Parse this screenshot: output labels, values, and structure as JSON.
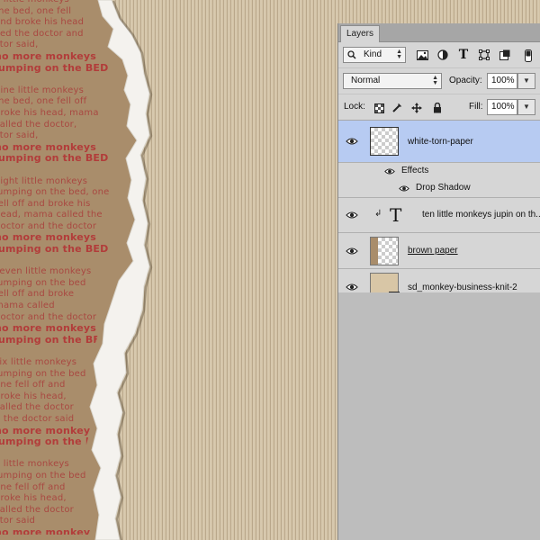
{
  "canvas": {
    "text_lines": [
      {
        "text": "e little monkeys",
        "emph": false
      },
      {
        "text": "the bed, one fell",
        "emph": false
      },
      {
        "text": "and broke his head",
        "emph": false
      },
      {
        "text": "lled the doctor and",
        "emph": false
      },
      {
        "text": "ctor said,",
        "emph": false
      },
      {
        "text": "no more monkeys",
        "emph": true
      },
      {
        "text": "jumping on the BED",
        "emph": true
      },
      {
        "text": "",
        "emph": false
      },
      {
        "text": "nine little monkeys",
        "emph": false
      },
      {
        "text": "the bed, one fell off",
        "emph": false
      },
      {
        "text": "broke his head, mama",
        "emph": false
      },
      {
        "text": "called the doctor,",
        "emph": false
      },
      {
        "text": "ctor said,",
        "emph": false
      },
      {
        "text": "no more monkeys",
        "emph": true
      },
      {
        "text": "jumping on the BED",
        "emph": true
      },
      {
        "text": "",
        "emph": false
      },
      {
        "text": "eight little monkeys",
        "emph": false
      },
      {
        "text": "jumping on the bed, one",
        "emph": false
      },
      {
        "text": "fell off and broke his",
        "emph": false
      },
      {
        "text": "head, mama called the",
        "emph": false
      },
      {
        "text": "doctor and the doctor",
        "emph": false
      },
      {
        "text": "no more monkeys",
        "emph": true
      },
      {
        "text": "jumping on the BED",
        "emph": true
      },
      {
        "text": "",
        "emph": false
      },
      {
        "text": "seven little monkeys",
        "emph": false
      },
      {
        "text": "jumping on the bed",
        "emph": false
      },
      {
        "text": "fell off and broke",
        "emph": false
      },
      {
        "text": "mama called",
        "emph": false
      },
      {
        "text": "doctor and the doctor",
        "emph": false
      },
      {
        "text": "no more monkeys",
        "emph": true
      },
      {
        "text": "jumping on the BED",
        "emph": true
      },
      {
        "text": "",
        "emph": false
      },
      {
        "text": "six little monkeys",
        "emph": false
      },
      {
        "text": "jumping on the bed",
        "emph": false
      },
      {
        "text": "one fell off and",
        "emph": false
      },
      {
        "text": "broke his head,",
        "emph": false
      },
      {
        "text": "called the doctor",
        "emph": false
      },
      {
        "text": "d the doctor said",
        "emph": false
      },
      {
        "text": "no more monkeys",
        "emph": true
      },
      {
        "text": "jumping on the BED",
        "emph": true
      },
      {
        "text": "",
        "emph": false
      },
      {
        "text": "e little monkeys",
        "emph": false
      },
      {
        "text": "jumping on the bed",
        "emph": false
      },
      {
        "text": "one fell off and",
        "emph": false
      },
      {
        "text": "broke his head,",
        "emph": false
      },
      {
        "text": "called the doctor",
        "emph": false
      },
      {
        "text": "ctor said",
        "emph": false
      },
      {
        "text": "no more monkeys",
        "emph": true
      }
    ]
  },
  "panel": {
    "tab": "Layers",
    "filter_kind": "Kind",
    "blend_mode": "Normal",
    "opacity_label": "Opacity:",
    "opacity_value": "100%",
    "lock_label": "Lock:",
    "fill_label": "Fill:",
    "fill_value": "100%",
    "layers": [
      {
        "name": "white-torn-paper",
        "selected": true
      },
      {
        "name": "ten little monkeys jupin on th...",
        "type": "text"
      },
      {
        "name": "brown paper"
      },
      {
        "name": "sd_monkey-business-knit-2",
        "type": "smart-object"
      }
    ],
    "effects_label": "Effects",
    "effect_drop_shadow": "Drop Shadow"
  },
  "colors": {
    "selection": "#b7cbf2",
    "text_red": "#a94841",
    "canvas_beige": "#d3c3a6",
    "brown_paper": "#a98d6b"
  }
}
